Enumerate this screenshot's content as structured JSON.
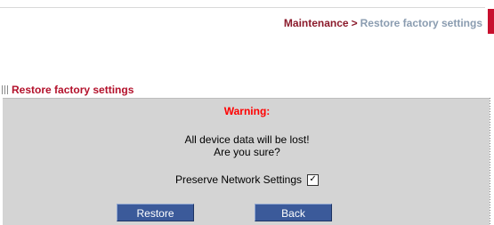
{
  "breadcrumb": {
    "section": "Maintenance",
    "separator": ">",
    "current": "Restore factory settings"
  },
  "section_header": {
    "title": "Restore factory settings"
  },
  "warning": {
    "title": "Warning:",
    "line1": "All device data will be lost!",
    "line2": "Are you sure?"
  },
  "preserve": {
    "label": "Preserve Network Settings",
    "checked": true,
    "check_glyph": "✓"
  },
  "buttons": {
    "restore_label": "Restore",
    "back_label": "Back"
  },
  "colors": {
    "section_title": "#b3112b",
    "warning": "#ff0000",
    "button": "#3b5a9a",
    "panel": "#d4d4d4"
  }
}
